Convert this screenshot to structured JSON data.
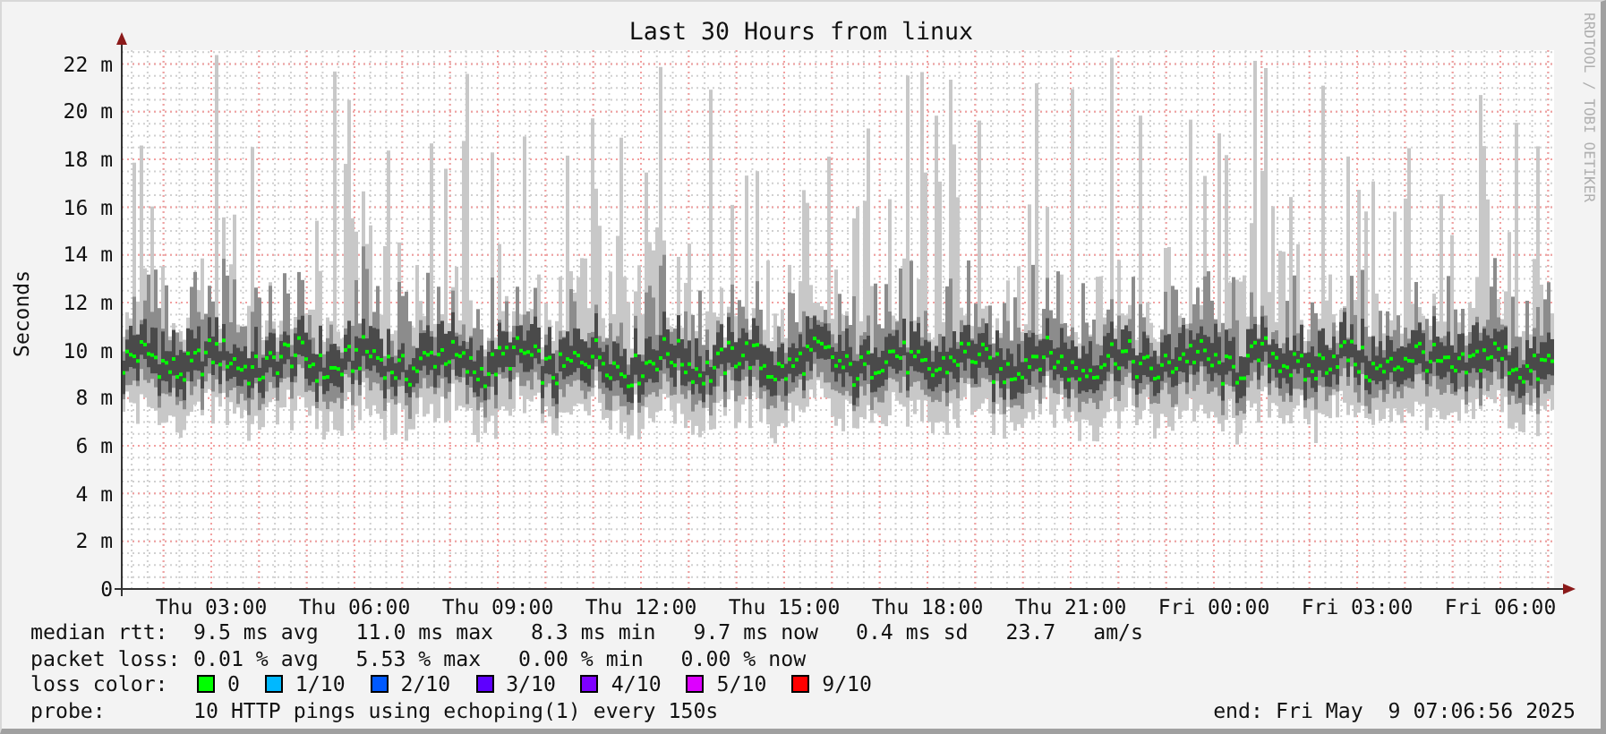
{
  "title": "Last 30 Hours from linux",
  "credit": "RRDTOOL / TOBI OETIKER",
  "y_axis": {
    "label": "Seconds",
    "ticks": [
      "22 m",
      "20 m",
      "18 m",
      "16 m",
      "14 m",
      "12 m",
      "10 m",
      "8 m",
      "6 m",
      "4 m",
      "2 m",
      "0"
    ]
  },
  "x_axis": {
    "ticks": [
      "Thu 03:00",
      "Thu 06:00",
      "Thu 09:00",
      "Thu 12:00",
      "Thu 15:00",
      "Thu 18:00",
      "Thu 21:00",
      "Fri 00:00",
      "Fri 03:00",
      "Fri 06:00"
    ]
  },
  "stats": [
    {
      "label": "median rtt:",
      "values": [
        "9.5 ms avg",
        "11.0 ms max",
        "8.3 ms min",
        "9.7 ms now",
        "0.4 ms sd",
        "23.7   am/s"
      ]
    },
    {
      "label": "packet loss:",
      "values": [
        "0.01 % avg",
        "5.53 % max",
        "0.00 % min",
        "0.00 % now"
      ]
    }
  ],
  "loss_colors": {
    "label": "loss color:",
    "items": [
      {
        "label": "0",
        "color": "#00ff00"
      },
      {
        "label": "1/10",
        "color": "#00b8ff"
      },
      {
        "label": "2/10",
        "color": "#0059ff"
      },
      {
        "label": "3/10",
        "color": "#5e00ff"
      },
      {
        "label": "4/10",
        "color": "#7e00ff"
      },
      {
        "label": "5/10",
        "color": "#dd00ff"
      },
      {
        "label": "9/10",
        "color": "#ff0000"
      }
    ]
  },
  "probe": {
    "label": "probe:",
    "text": "10 HTTP pings using echoping(1) every 150s"
  },
  "end": "end: Fri May  9 07:06:56 2025"
}
